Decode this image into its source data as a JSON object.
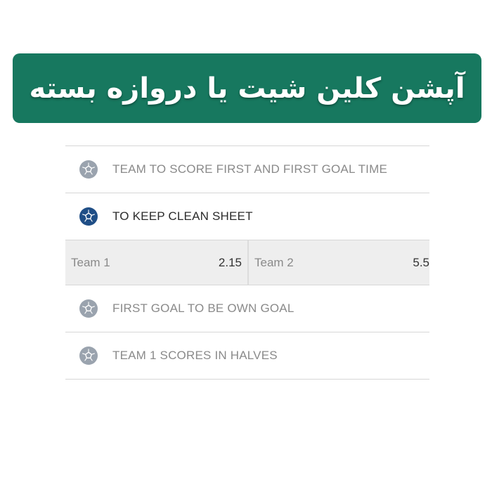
{
  "banner": {
    "title": "آپشن کلین شیت یا دروازه بسته",
    "background_color": "#17785f",
    "text_color": "#ffffff"
  },
  "colors": {
    "ball_inactive": "#9aa3ae",
    "ball_active": "#1f4e86",
    "odds_background": "#eeeeee"
  },
  "markets": [
    {
      "label": "TEAM TO SCORE FIRST AND FIRST GOAL TIME",
      "icon": "soccer-ball-icon",
      "active": false
    },
    {
      "label": "TO KEEP CLEAN SHEET",
      "icon": "soccer-ball-icon",
      "active": true
    },
    {
      "label": "FIRST GOAL TO BE OWN GOAL",
      "icon": "soccer-ball-icon",
      "active": false
    },
    {
      "label": "TEAM 1 SCORES IN HALVES",
      "icon": "soccer-ball-icon",
      "active": false
    }
  ],
  "odds": [
    {
      "team": "Team 1",
      "value": "2.15"
    },
    {
      "team": "Team 2",
      "value": "5.5"
    }
  ]
}
